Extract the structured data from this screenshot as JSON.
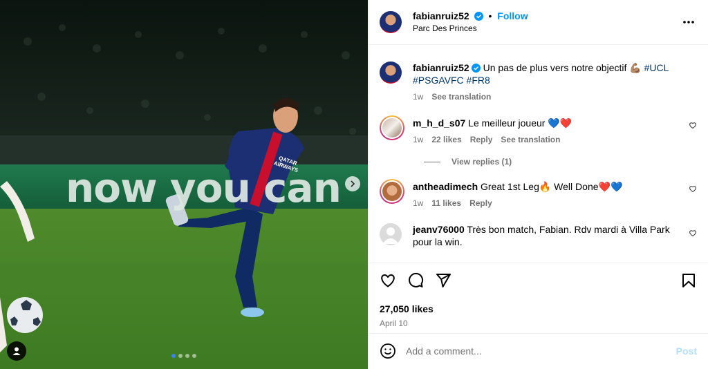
{
  "post": {
    "author": "fabianruiz52",
    "follow_label": "Follow",
    "dot": "•",
    "location": "Parc Des Princes",
    "more_icon": "more-horizontal-icon"
  },
  "media": {
    "banner_text": "now you can",
    "jersey_text": "QATAR AIRWAYS",
    "carousel_count": 4,
    "carousel_active": 1
  },
  "caption": {
    "username": "fabianruiz52",
    "text_before": "Un pas de plus vers notre objectif ",
    "emoji": "💪🏽",
    "hashtag1": "#UCL",
    "hashtag2": "#PSGAVFC",
    "hashtag3": "#FR8",
    "time": "1w",
    "translate": "See translation"
  },
  "comments": [
    {
      "username": "m_h_d_s07",
      "text": "Le meilleur joueur ",
      "emoji": "💙❤️",
      "time": "1w",
      "likes": "22 likes",
      "reply": "Reply",
      "translate": "See translation",
      "view_replies": "View replies (1)"
    },
    {
      "username": "antheadimech",
      "text": "Great 1st Leg",
      "emoji_mid": "🔥",
      "text2": " Well Done",
      "emoji": "❤️💙",
      "time": "1w",
      "likes": "11 likes",
      "reply": "Reply"
    },
    {
      "username": "jeanv76000",
      "text": "Très bon match, Fabian. Rdv mardi à Villa Park pour la win."
    }
  ],
  "stats": {
    "likes": "27,050 likes",
    "date": "April 10"
  },
  "composer": {
    "placeholder": "Add a comment...",
    "post_label": "Post"
  },
  "colors": {
    "accent": "#0095f6",
    "post_disabled": "#b2dffc",
    "secondary_text": "#737373"
  }
}
